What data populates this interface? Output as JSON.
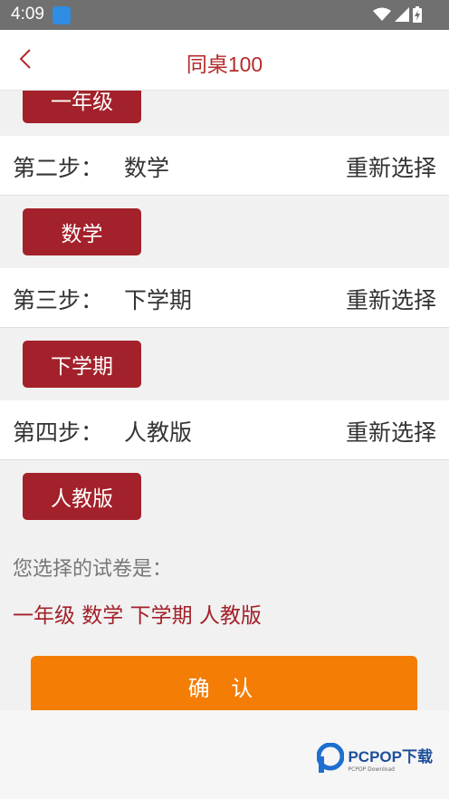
{
  "status": {
    "time": "4:09"
  },
  "header": {
    "title": "同桌100"
  },
  "steps": [
    {
      "chip": "一年级"
    },
    {
      "label": "第二步：",
      "value": "数学",
      "reselect": "重新选择",
      "chip": "数学"
    },
    {
      "label": "第三步：",
      "value": "下学期",
      "reselect": "重新选择",
      "chip": "下学期"
    },
    {
      "label": "第四步：",
      "value": "人教版",
      "reselect": "重新选择",
      "chip": "人教版"
    }
  ],
  "summary": {
    "label": "您选择的试卷是：",
    "value": "一年级 数学 下学期 人教版"
  },
  "confirm_label": "确 认",
  "watermark": {
    "brand": "PCPOP下载",
    "sub": "PCPOP Download"
  },
  "colors": {
    "primary": "#a3212a",
    "accent": "#f37d05",
    "title": "#b52b2b"
  }
}
